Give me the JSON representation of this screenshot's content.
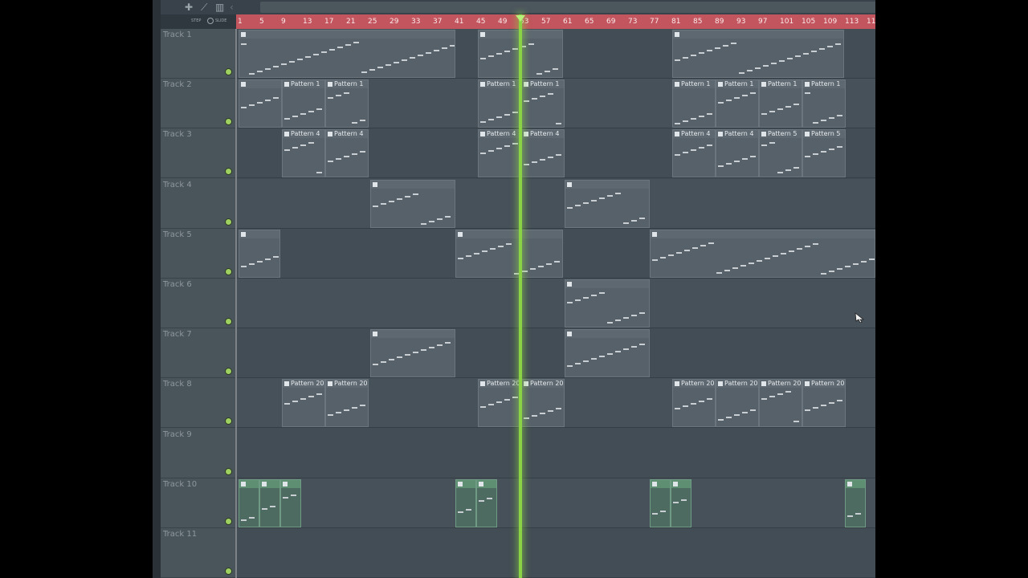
{
  "toolbar": {
    "icons": [
      "magnet-icon",
      "draw-icon",
      "slice-icon",
      "arrow-left-icon"
    ]
  },
  "stepslide": {
    "step": "STEP",
    "slide": "SLIDE"
  },
  "ruler": {
    "bars": [
      "1",
      "5",
      "9",
      "13",
      "17",
      "21",
      "25",
      "29",
      "33",
      "37",
      "41",
      "45",
      "49",
      "53",
      "57",
      "61",
      "65",
      "69",
      "73",
      "77",
      "81",
      "85",
      "89",
      "93",
      "97",
      "101",
      "105",
      "109",
      "113",
      "11"
    ]
  },
  "playhead": {
    "bar": "53"
  },
  "tracks": [
    {
      "name": "Track 1",
      "clips": []
    },
    {
      "name": "Track 2",
      "clips": [
        {
          "label": "Pattern 1"
        },
        {
          "label": "Pattern 1"
        },
        {
          "label": "Pattern 1"
        },
        {
          "label": "Pattern 1"
        },
        {
          "label": "Pattern 1"
        },
        {
          "label": "Pattern 1"
        },
        {
          "label": "Pattern 1"
        },
        {
          "label": "Pattern 1"
        }
      ]
    },
    {
      "name": "Track 3",
      "clips": [
        {
          "label": "Pattern 4"
        },
        {
          "label": "Pattern 4"
        },
        {
          "label": "Pattern 4"
        },
        {
          "label": "Pattern 4"
        },
        {
          "label": "Pattern 4"
        },
        {
          "label": "Pattern 4"
        },
        {
          "label": "Pattern 5"
        },
        {
          "label": "Pattern 5"
        }
      ]
    },
    {
      "name": "Track 4",
      "clips": []
    },
    {
      "name": "Track 5",
      "clips": []
    },
    {
      "name": "Track 6",
      "clips": []
    },
    {
      "name": "Track 7",
      "clips": []
    },
    {
      "name": "Track 8",
      "clips": [
        {
          "label": "Pattern 20"
        },
        {
          "label": "Pattern 20"
        },
        {
          "label": "Pattern 20"
        },
        {
          "label": "Pattern 20"
        },
        {
          "label": "Pattern 20"
        },
        {
          "label": "Pattern 20"
        },
        {
          "label": "Pattern 20"
        },
        {
          "label": "Pattern 20"
        }
      ]
    },
    {
      "name": "Track 9",
      "clips": []
    },
    {
      "name": "Track 10",
      "clips": []
    },
    {
      "name": "Track 11",
      "clips": []
    }
  ],
  "colors": {
    "ruler": "#c2555e",
    "playhead": "#8ad346",
    "led": "#9ed15f",
    "clip": "#57616a",
    "automation": "#5e8f73"
  }
}
